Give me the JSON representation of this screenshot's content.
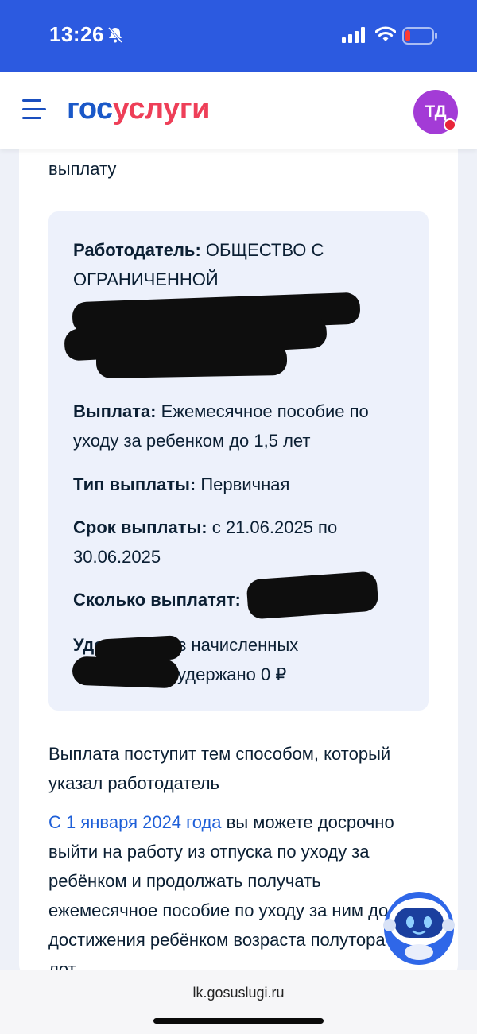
{
  "status_bar": {
    "time": "13:26",
    "icons": [
      "bell-muted-icon",
      "signal-icon",
      "wifi-icon",
      "battery-low-icon"
    ],
    "color": "#2c5ae0"
  },
  "header": {
    "logo_part1": "гос",
    "logo_part2": "услуги",
    "avatar_initials": "ТД",
    "icons": [
      "menu-icon"
    ]
  },
  "content": {
    "cut_text": "выплату",
    "employer_label": "Работодатель:",
    "employer_value": "ОБЩЕСТВО С ОГРАНИЧЕННОЙ",
    "payment_label": "Выплата:",
    "payment_value": "Ежемесячное пособие по уходу за ребенком до 1,5 лет",
    "type_label": "Тип выплаты:",
    "type_value": "Первичная",
    "period_label": "Срок выплаты:",
    "period_value": "с 21.06.2025 по 30.06.2025",
    "amount_label": "Сколько выплатят:",
    "withheld_label": "Удержано:",
    "withheld_value_line1": "из начисленных",
    "withheld_value_line2": "удержано 0 ₽",
    "method_text": "Выплата поступит тем способом, который указал работодатель",
    "info_link": "С 1 января 2024 года",
    "info_text": "вы можете досрочно выйти на работу из отпуска по уходу за ребёнком и продолжать получать ежемесячное пособие по уходу за ним до достижения ребёнком возраста полутора лет"
  },
  "bottom": {
    "url": "lk.gosuslugi.ru"
  },
  "colors": {
    "accent": "#1e5fd8",
    "logo_red": "#ee3f58",
    "avatar": "#a33bd6",
    "info_box": "#edf1fb"
  }
}
